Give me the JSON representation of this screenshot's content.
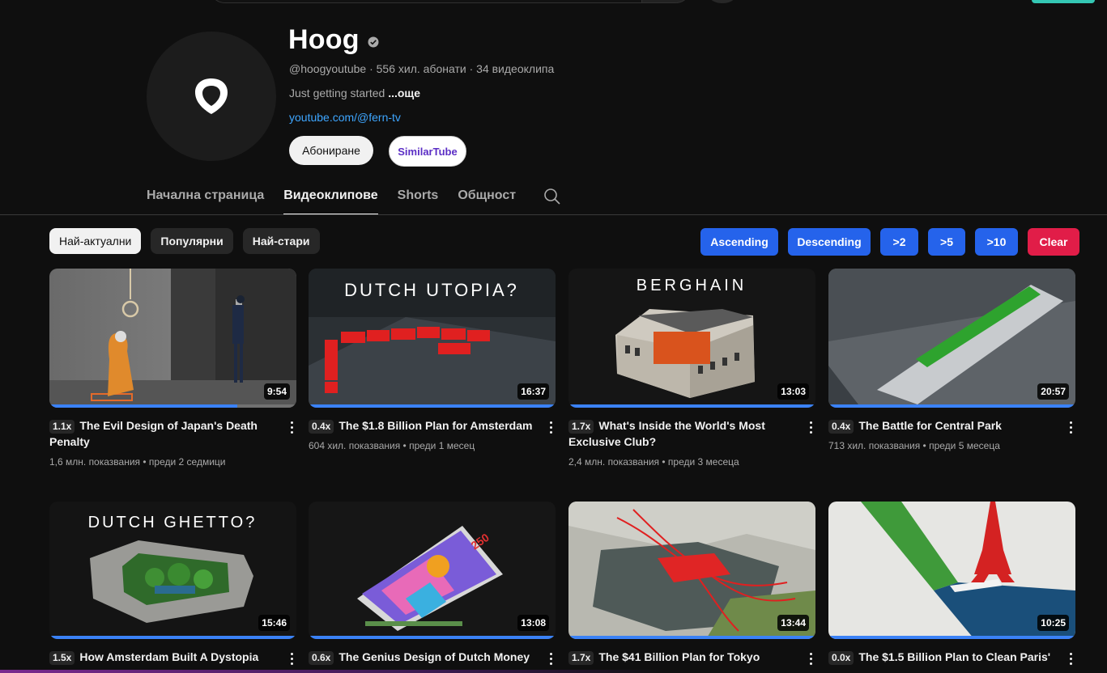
{
  "channel": {
    "name": "Hoog",
    "handle": "@hoogyoutube",
    "subscribers": "556 хил. абонати",
    "video_count": "34 видеоклипа",
    "separator": "·",
    "about": "Just getting started",
    "more": "...още",
    "link": "youtube.com/@fern-tv",
    "subscribe_label": "Абониране",
    "similar_label": "SimilarTube"
  },
  "tabs": [
    {
      "label": "Начална страница"
    },
    {
      "label": "Видеоклипове"
    },
    {
      "label": "Shorts"
    },
    {
      "label": "Общност"
    }
  ],
  "chips": [
    {
      "label": "Най-актуални"
    },
    {
      "label": "Популярни"
    },
    {
      "label": "Най-стари"
    }
  ],
  "filters": {
    "ascending": "Ascending",
    "descending": "Descending",
    "gt2": ">2",
    "gt5": ">5",
    "gt10": ">10",
    "clear": "Clear"
  },
  "colors": {
    "filter_blue": "#2563eb",
    "clear_red": "#e11d48",
    "progress_blue": "#3b82f6",
    "link_blue": "#3ea6ff"
  },
  "videos": [
    {
      "ratio": "1.1x",
      "title": "The Evil Design of Japan's Death Penalty",
      "views": "1,6 млн. показвания",
      "age": "преди 2 седмици",
      "duration": "9:54",
      "progress": 0.76,
      "thumb_text": ""
    },
    {
      "ratio": "0.4x",
      "title": "The $1.8 Billion Plan for Amsterdam",
      "views": "604 хил. показвания",
      "age": "преди 1 месец",
      "duration": "16:37",
      "progress": 1.0,
      "thumb_text": "DUTCH UTOPIA?"
    },
    {
      "ratio": "1.7x",
      "title": "What's Inside the World's Most Exclusive Club?",
      "views": "2,4 млн. показвания",
      "age": "преди 3 месеца",
      "duration": "13:03",
      "progress": 1.0,
      "thumb_text": "BERGHAIN"
    },
    {
      "ratio": "0.4x",
      "title": "The Battle for Central Park",
      "views": "713 хил. показвания",
      "age": "преди 5 месеца",
      "duration": "20:57",
      "progress": 1.0,
      "thumb_text": ""
    },
    {
      "ratio": "1.5x",
      "title": "How Amsterdam Built A Dystopia",
      "views": "",
      "age": "",
      "duration": "15:46",
      "progress": 1.0,
      "thumb_text": "DUTCH GHETTO?"
    },
    {
      "ratio": "0.6x",
      "title": "The Genius Design of Dutch Money",
      "views": "",
      "age": "",
      "duration": "13:08",
      "progress": 1.0,
      "thumb_text": ""
    },
    {
      "ratio": "1.7x",
      "title": "The $41 Billion Plan for Tokyo",
      "views": "",
      "age": "",
      "duration": "13:44",
      "progress": 1.0,
      "thumb_text": ""
    },
    {
      "ratio": "0.0x",
      "title": "The $1.5 Billion Plan to Clean Paris'",
      "views": "",
      "age": "",
      "duration": "10:25",
      "progress": 1.0,
      "thumb_text": ""
    }
  ],
  "meta_separator": "•"
}
